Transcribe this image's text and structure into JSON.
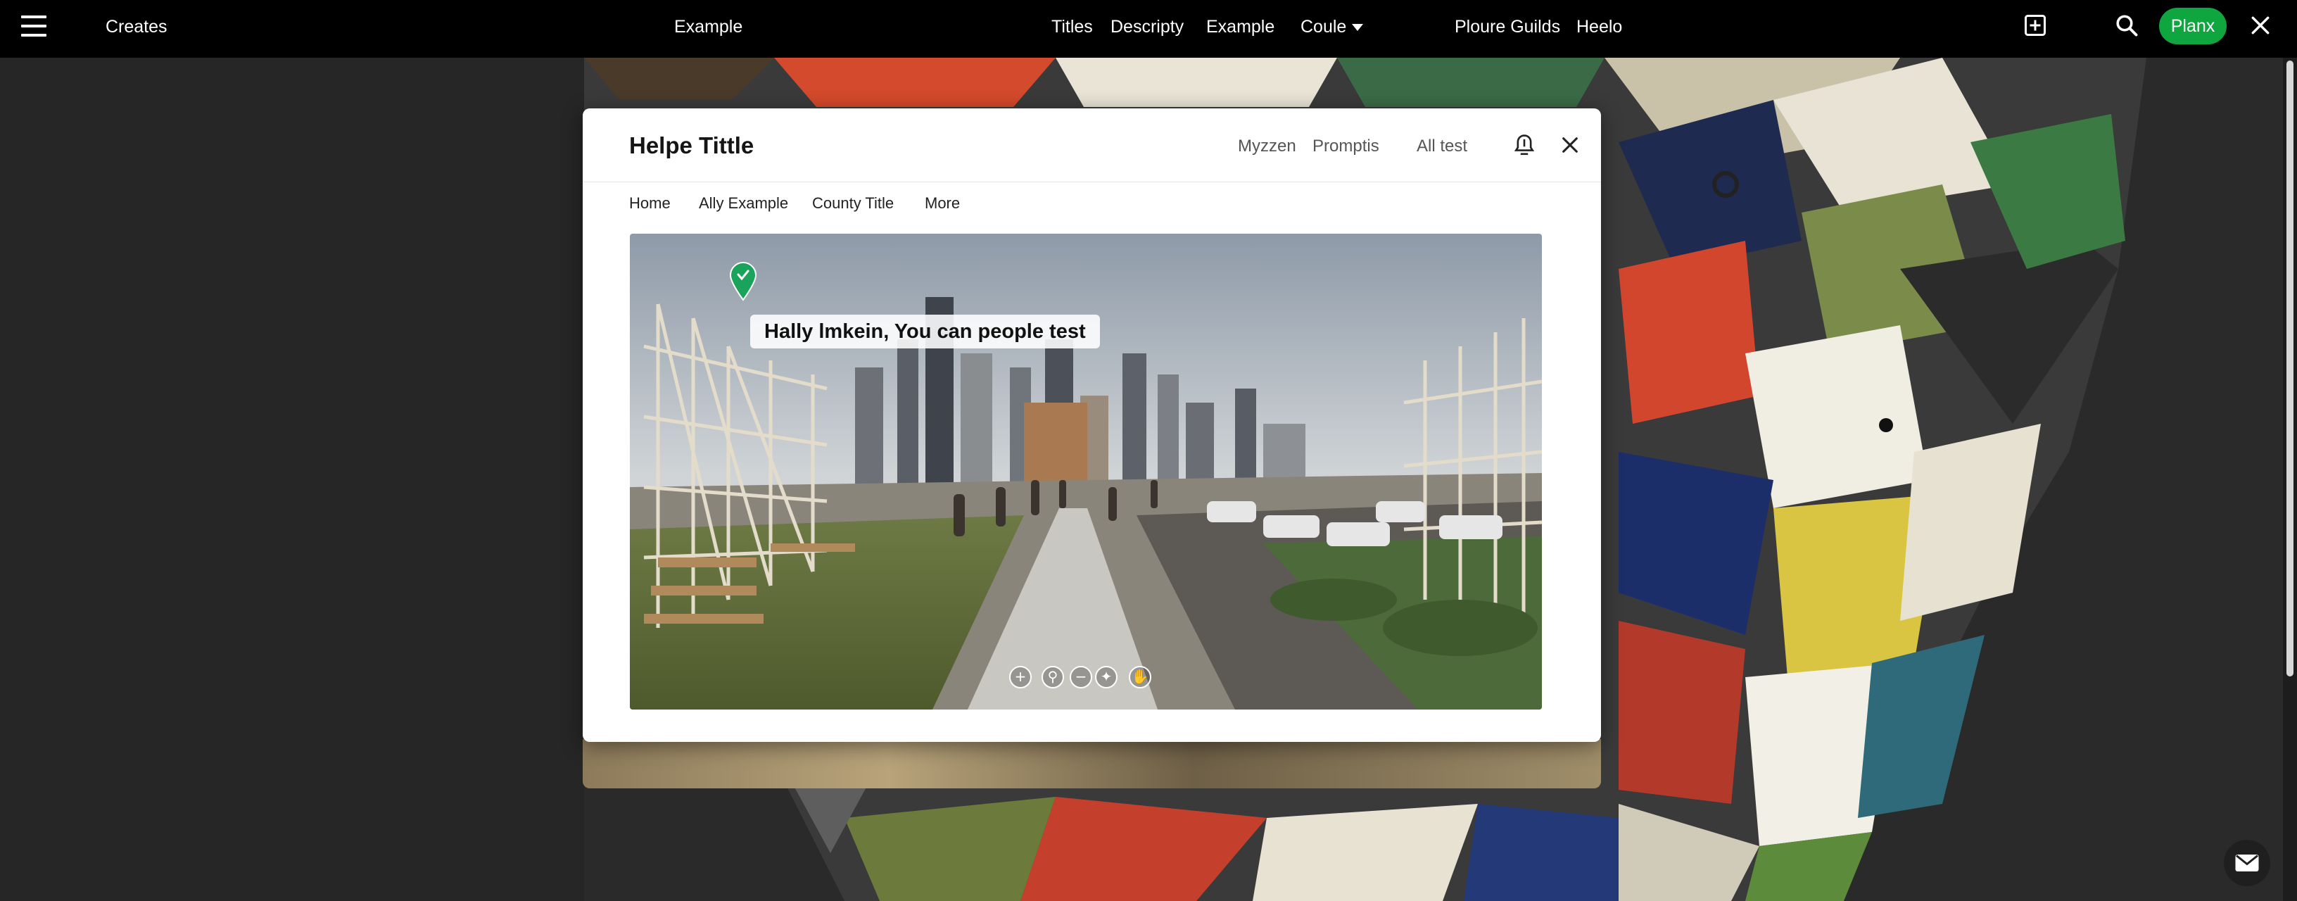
{
  "topbar": {
    "menu_icon": "hamburger-menu-icon",
    "brand": "Creates",
    "center_link": "Example",
    "nav": [
      "Titles",
      "Descripty",
      "Example",
      "Coule"
    ],
    "right_links": [
      "Ploure Guilds",
      "Heelo"
    ],
    "cta_label": "Planx",
    "cta_color": "#0fa53f",
    "icons": [
      "add-box-icon",
      "search-icon",
      "close-icon"
    ]
  },
  "modal": {
    "title": "Helpe Tittle",
    "header_links": [
      "Myzzen",
      "Promptis",
      "All test"
    ],
    "header_icons": [
      "bookmark-icon",
      "close-icon"
    ],
    "subnav": [
      "Home",
      "Ally Example",
      "County Title",
      "More"
    ],
    "photo": {
      "caption": "Hally lmkein, You can people test",
      "pin_icon": "map-pin-icon",
      "pin_color": "#1aa35b",
      "controls": [
        {
          "icon": "zoom-in-icon",
          "glyph": "+"
        },
        {
          "icon": "search-zoom-icon",
          "glyph": "⚲"
        },
        {
          "icon": "zoom-out-icon",
          "glyph": "−"
        },
        {
          "icon": "rotate-icon",
          "glyph": "✦"
        },
        {
          "icon": "hand-icon",
          "glyph": "✋"
        }
      ]
    }
  },
  "chat_icon": "chat-message-icon"
}
